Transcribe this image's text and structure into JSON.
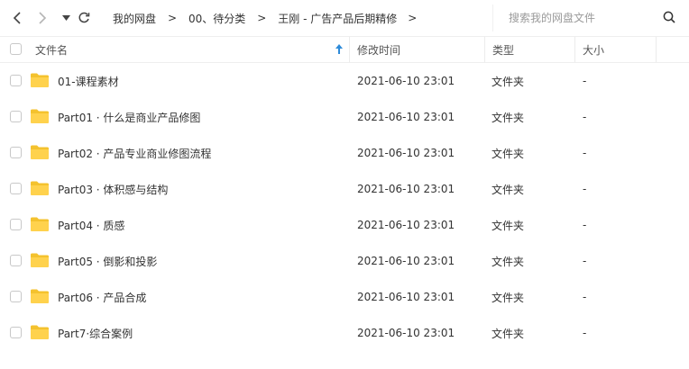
{
  "toolbar": {
    "back_icon": "chevron-left-icon",
    "forward_icon": "chevron-right-icon",
    "history_icon": "caret-down-icon",
    "refresh_icon": "refresh-icon"
  },
  "breadcrumb": [
    "我的网盘",
    "00、待分类",
    "王刚 - 广告产品后期精修"
  ],
  "search": {
    "placeholder": "搜索我的网盘文件"
  },
  "columns": {
    "name": "文件名",
    "modified": "修改时间",
    "type": "类型",
    "size": "大小"
  },
  "colors": {
    "folder": "#ffd24d",
    "folder_tab": "#f4c22e",
    "sort_arrow": "#2e8bd9"
  },
  "files": [
    {
      "name": "01-课程素材",
      "modified": "2021-06-10 23:01",
      "type": "文件夹",
      "size": "-"
    },
    {
      "name": "Part01 · 什么是商业产品修图",
      "modified": "2021-06-10 23:01",
      "type": "文件夹",
      "size": "-"
    },
    {
      "name": "Part02 · 产品专业商业修图流程",
      "modified": "2021-06-10 23:01",
      "type": "文件夹",
      "size": "-"
    },
    {
      "name": "Part03 · 体积感与结构",
      "modified": "2021-06-10 23:01",
      "type": "文件夹",
      "size": "-"
    },
    {
      "name": "Part04 · 质感",
      "modified": "2021-06-10 23:01",
      "type": "文件夹",
      "size": "-"
    },
    {
      "name": "Part05 · 倒影和投影",
      "modified": "2021-06-10 23:01",
      "type": "文件夹",
      "size": "-"
    },
    {
      "name": "Part06 · 产品合成",
      "modified": "2021-06-10 23:01",
      "type": "文件夹",
      "size": "-"
    },
    {
      "name": "Part7·综合案例",
      "modified": "2021-06-10 23:01",
      "type": "文件夹",
      "size": "-"
    }
  ]
}
